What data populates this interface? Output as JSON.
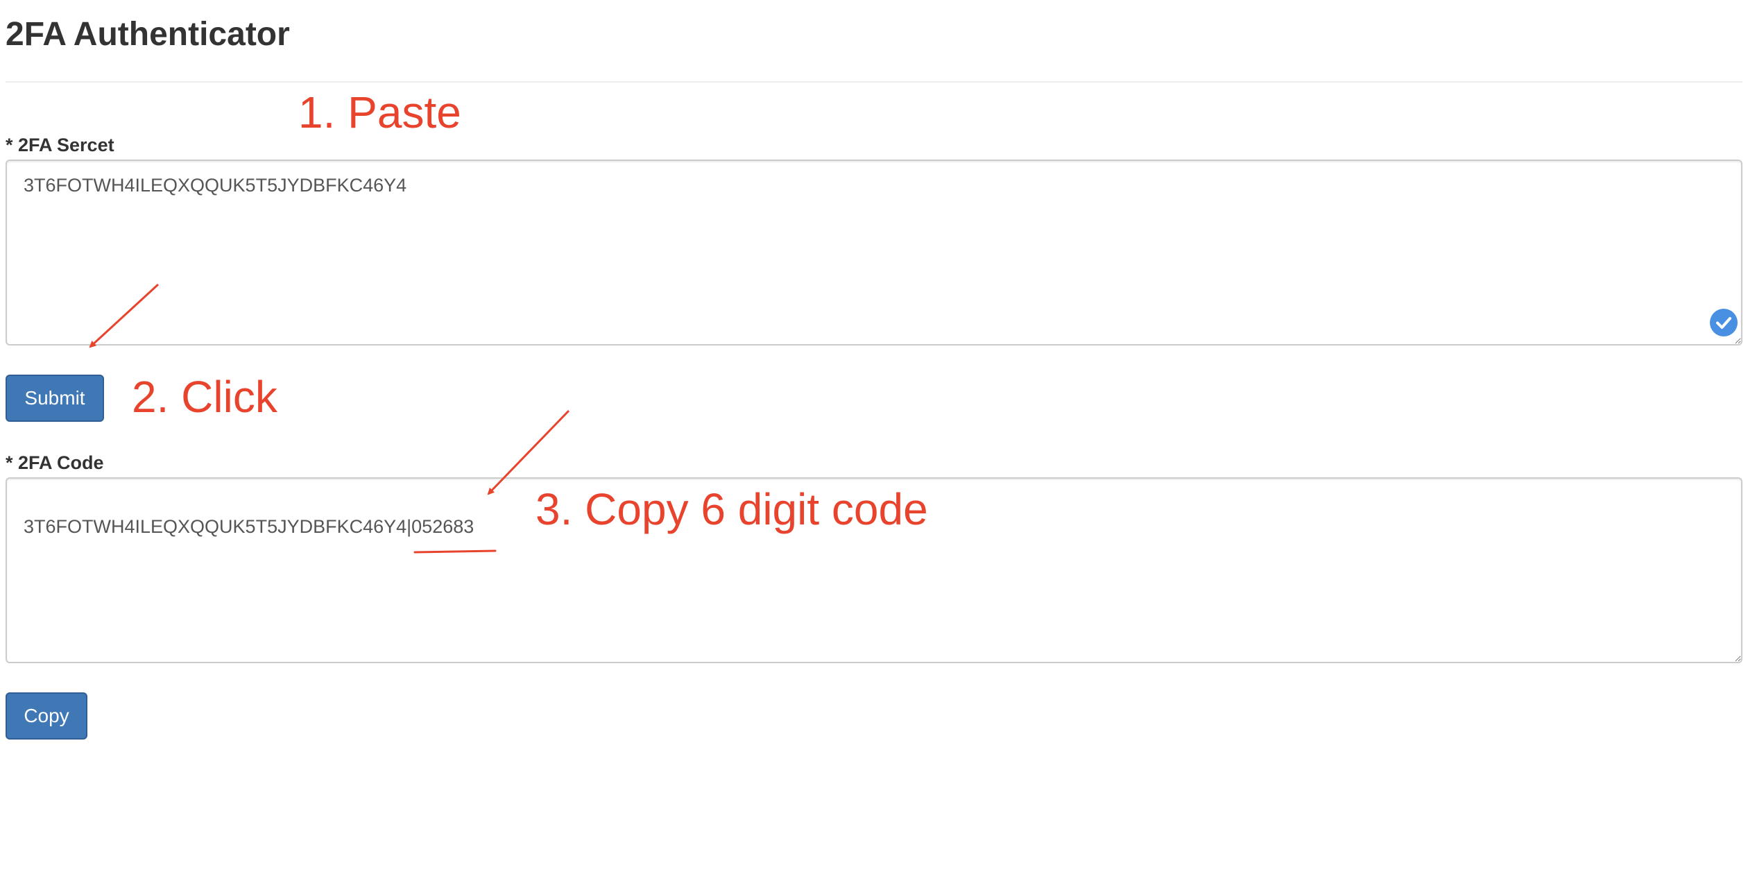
{
  "app": {
    "title": "2FA Authenticator"
  },
  "secret": {
    "label": "* 2FA Sercet",
    "value": "3T6FOTWH4ILEQXQQUK5T5JYDBFKC46Y4",
    "status_icon": "check-circle-icon"
  },
  "submit": {
    "label": "Submit"
  },
  "code": {
    "label": "* 2FA Code",
    "value": "3T6FOTWH4ILEQXQQUK5T5JYDBFKC46Y4|052683"
  },
  "copy": {
    "label": "Copy"
  },
  "annotations": {
    "step1": "1. Paste",
    "step2": "2. Click",
    "step3": "3. Copy 6 digit code"
  },
  "colors": {
    "accent": "#3f78b5",
    "annotation": "#e8432d",
    "check": "#4a90e2"
  }
}
